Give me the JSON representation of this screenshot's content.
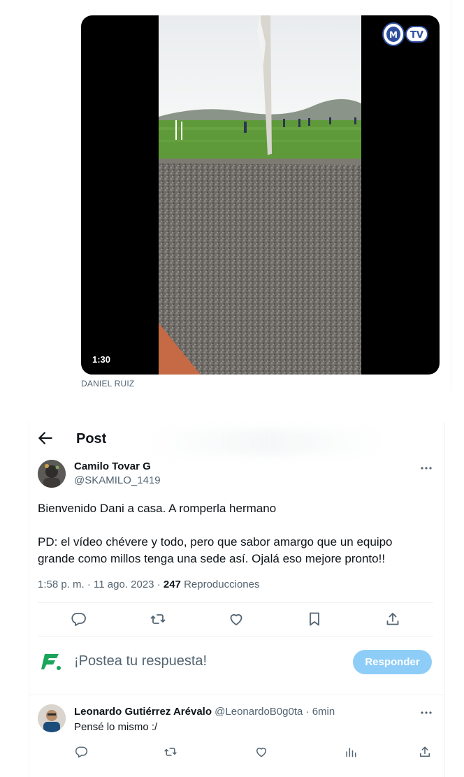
{
  "video": {
    "duration": "1:30",
    "credit": "DANIEL RUIZ",
    "logo_text": "TV",
    "logo_badge_text": "M"
  },
  "header": {
    "title": "Post"
  },
  "post": {
    "author_name": "Camilo Tovar G",
    "author_handle": "@SKAMILO_1419",
    "text_line_1": "Bienvenido Dani a casa. A romperla hermano",
    "text_line_2": "PD: el vídeo chévere y todo, pero que sabor amargo que un equipo",
    "text_line_3": "grande como millos tenga una sede así. Ojalá eso mejore pronto!!",
    "time": "1:58 p. m.",
    "date": "11 ago. 2023",
    "dot": "·",
    "views_count": "247",
    "views_label": "Reproducciones"
  },
  "compose": {
    "prompt": "¡Postea tu respuesta!",
    "button_label": "Responder"
  },
  "reply": {
    "name": "Leonardo Gutiérrez Arévalo",
    "handle": "@LeonardoB0g0ta",
    "dot": "·",
    "time": "6min",
    "text": "Pensé lo mismo :/"
  },
  "icons": {
    "back": "arrow-left-icon",
    "more": "more-horizontal-icon",
    "reply": "comment-icon",
    "repost": "repost-icon",
    "like": "heart-icon",
    "bookmark": "bookmark-icon",
    "share": "share-icon",
    "views": "analytics-icon",
    "brand": "f-logo-icon"
  },
  "colors": {
    "text_primary": "#0f1419",
    "text_secondary": "#536471",
    "reply_button_bg": "#8ecdf7",
    "brand_green": "#1aa55a",
    "divider": "#eff3f4"
  }
}
